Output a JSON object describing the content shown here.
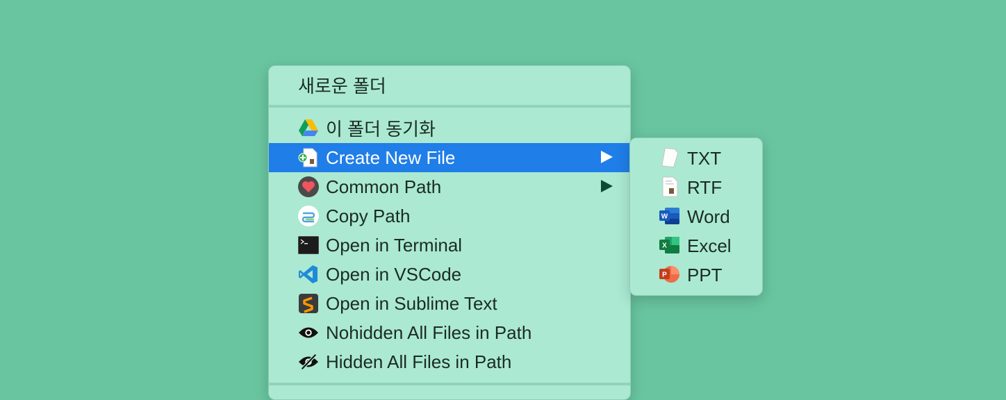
{
  "colors": {
    "background": "#69c5a0",
    "menu_background": "#abe9d2",
    "selected": "#1f7ee8"
  },
  "menu": {
    "items": [
      {
        "label": "새로운 폴더",
        "icon": null
      },
      {
        "label": "이 폴더 동기화",
        "icon": "google-drive-icon"
      },
      {
        "label": "Create New File",
        "icon": "new-file-icon",
        "submenu": true,
        "selected": true
      },
      {
        "label": "Common Path",
        "icon": "heart-icon",
        "submenu": true
      },
      {
        "label": "Copy Path",
        "icon": "copy-path-icon"
      },
      {
        "label": "Open in Terminal",
        "icon": "terminal-icon"
      },
      {
        "label": "Open in VSCode",
        "icon": "vscode-icon"
      },
      {
        "label": "Open in Sublime Text",
        "icon": "sublime-icon"
      },
      {
        "label": "Nohidden All Files in Path",
        "icon": "eye-icon"
      },
      {
        "label": "Hidden All Files in Path",
        "icon": "eye-slash-icon"
      }
    ]
  },
  "submenu": {
    "items": [
      {
        "label": "TXT",
        "icon": "txt-file-icon"
      },
      {
        "label": "RTF",
        "icon": "rtf-file-icon"
      },
      {
        "label": "Word",
        "icon": "word-icon"
      },
      {
        "label": "Excel",
        "icon": "excel-icon"
      },
      {
        "label": "PPT",
        "icon": "powerpoint-icon"
      }
    ]
  }
}
